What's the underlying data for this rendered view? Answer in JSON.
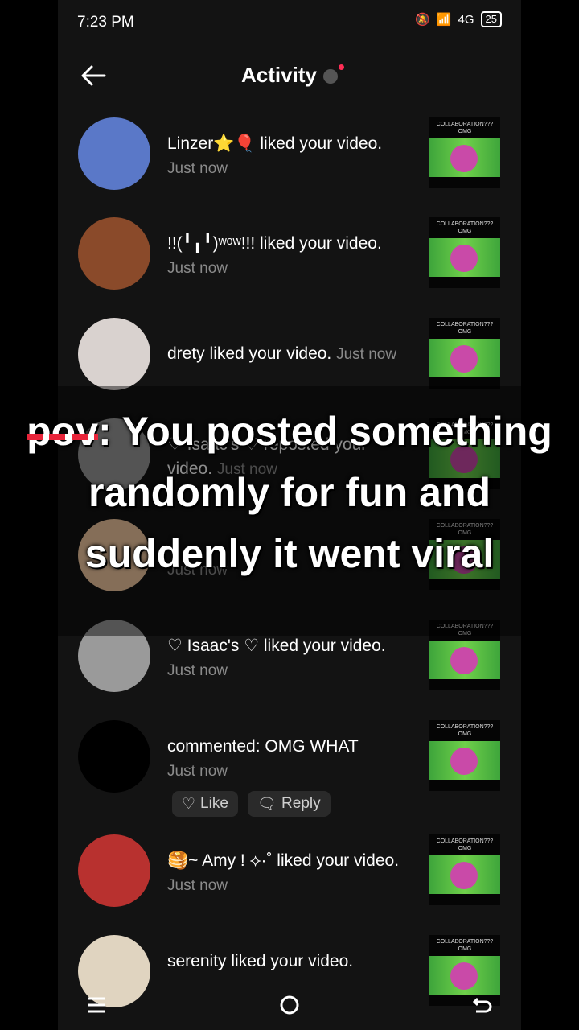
{
  "status_bar": {
    "time": "7:23 PM",
    "network": "4G",
    "battery": "25"
  },
  "header": {
    "title": "Activity"
  },
  "notifications": [
    {
      "name": "Linzer⭐🎈",
      "action": " liked your video.",
      "time": "Just now",
      "avatar_color": "#5a78c8",
      "thumb_caption": "COLLABORATION??? OMG"
    },
    {
      "name": "!!(╹╻╹)ʷᵒʷ!!!",
      "action": " liked your video.",
      "time": "Just now",
      "avatar_color": "#8a4a2a",
      "thumb_caption": "COLLABORATION??? OMG"
    },
    {
      "name": "drety",
      "action": " liked your video. ",
      "time": "Just now",
      "avatar_color": "#d9d2cf",
      "thumb_caption": "COLLABORATION??? OMG"
    },
    {
      "name": "♡ Isaac's ♡",
      "action": " reposted your video.",
      "time": "Just now",
      "avatar_color": "#9a9a9a",
      "thumb_caption": "COLLABORATION??? OMG"
    },
    {
      "name": "",
      "action": "",
      "time": "Just now",
      "avatar_color": "#f2c9a0",
      "thumb_caption": "COLLABORATION??? OMG"
    },
    {
      "name": "♡ Isaac's ♡",
      "action": " liked your video.",
      "time": "Just now",
      "avatar_color": "#9a9a9a",
      "thumb_caption": "COLLABORATION??? OMG"
    },
    {
      "name": "",
      "action": "commented: OMG WHAT",
      "time": "Just now",
      "avatar_color": "#000000",
      "thumb_caption": "COLLABORATION??? OMG"
    },
    {
      "name": "🥞~ Amy ! ⟡·˚",
      "action": " liked your video. ",
      "time": "Just now",
      "avatar_color": "#b8312f",
      "thumb_caption": "COLLABORATION??? OMG"
    },
    {
      "name": "serenity",
      "action": " liked your video.",
      "time": "",
      "avatar_color": "#e0d4c0",
      "thumb_caption": "COLLABORATION??? OMG"
    }
  ],
  "comment_actions": {
    "like": "Like",
    "reply": "Reply"
  },
  "overlay": {
    "struck": "pov",
    "text": ": You posted something randomly for fun and suddenly it went viral"
  }
}
